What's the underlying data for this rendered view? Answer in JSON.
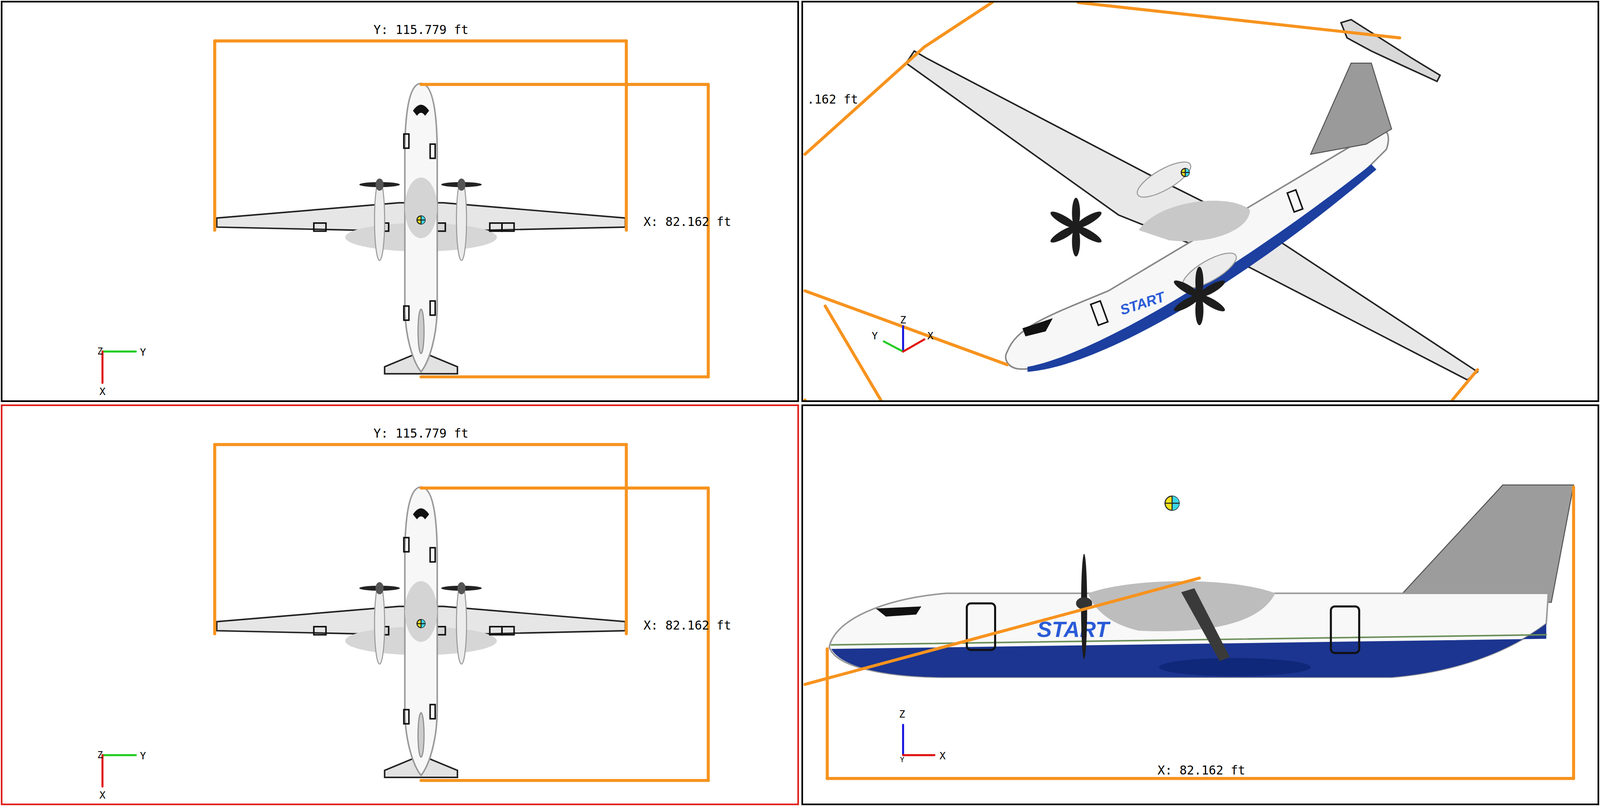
{
  "viewports": [
    {
      "kind": "top",
      "selected": false,
      "dims": [
        "Y: 115.779 ft",
        "X: 82.162 ft"
      ],
      "axes": [
        "Z",
        "Y",
        "X"
      ]
    },
    {
      "kind": "iso",
      "selected": false,
      "dims": [
        ".162 ft"
      ],
      "axes": [
        "Z",
        "Y",
        "X"
      ],
      "livery": "START"
    },
    {
      "kind": "top",
      "selected": true,
      "dims": [
        "Y: 115.779 ft",
        "X: 82.162 ft"
      ],
      "axes": [
        "Z",
        "Y",
        "X"
      ]
    },
    {
      "kind": "side",
      "selected": false,
      "dims": [
        "X: 82.162 ft"
      ],
      "axes": [
        "Z",
        "Y",
        "X"
      ],
      "livery": "START"
    }
  ]
}
